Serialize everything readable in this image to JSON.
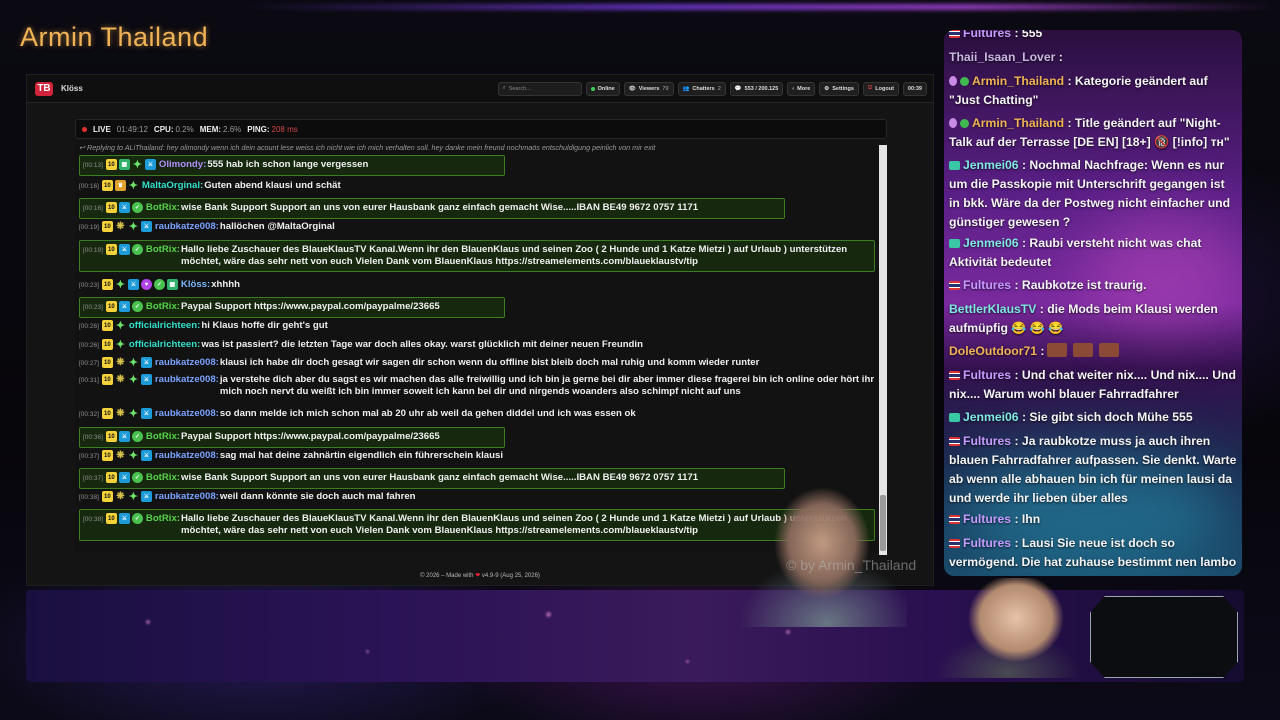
{
  "stream": {
    "title": "Armin Thailand",
    "watermark": "© by Armin_Thailand"
  },
  "app": {
    "name": "Klöss",
    "logo": "TB",
    "search_placeholder": "Search...",
    "status_online": "Online",
    "viewers_label": "Viewers",
    "viewers_count": "79",
    "chatters_label": "Chatters",
    "chatters_count": "2",
    "messages": "553 / 200.125",
    "more_label": "More",
    "settings_label": "Settings",
    "logout_label": "Logout",
    "timer": "00:39",
    "accent_red": "#d0243a"
  },
  "status": {
    "live_label": "LIVE",
    "live_time": "01:49:12",
    "cpu_label": "CPU:",
    "cpu_value": "0.2%",
    "mem_label": "MEM:",
    "mem_value": "2.6%",
    "ping_label": "PING:",
    "ping_value": "208 ms"
  },
  "reply_line": "Replying to ALiThailand: hey olimondy wenn ich dein acount lese weiss ich nicht wie ich mich verhalten soll. hey danke mein freund nochmaös entschuldigung peinlich von mir exit",
  "messages": [
    {
      "ts": "[00:13]",
      "badges": [
        "sub",
        "grn",
        "gem",
        "mod"
      ],
      "user": "Olimondy",
      "color": "#b28cff",
      "text": "555 hab ich schon lange vergessen",
      "hl": true
    },
    {
      "ts": "[00:16]",
      "badges": [
        "sub",
        "vip",
        "gem"
      ],
      "user": "MaltaOrginal",
      "color": "#33e0c8",
      "text": "Guten abend klausi und schät",
      "hl": false
    },
    {
      "ts": "[00:16]",
      "badges": [
        "sub",
        "mod",
        "bot"
      ],
      "user": "BotRix",
      "color": "#57d14a",
      "text": "wise Bank Support Support an uns von eurer Hausbank ganz einfach gemacht Wise.....IBAN BE49 9672 0757 1171",
      "hl": true
    },
    {
      "ts": "[00:19]",
      "badges": [
        "sub",
        "hype",
        "gem",
        "mod"
      ],
      "user": "raubkatze008",
      "color": "#7aa2ff",
      "text": "hallöchen @MaltaOrginal",
      "hl": false
    },
    {
      "ts": "[00:19]",
      "badges": [
        "sub",
        "mod",
        "bot"
      ],
      "user": "BotRix",
      "color": "#57d14a",
      "text": "Hallo liebe Zuschauer des BlaueKlausTV Kanal.Wenn ihr den BlauenKlaus und seinen Zoo ( 2 Hunde und 1 Katze Mietzi ) auf Urlaub ) unterstützen möchtet, wäre das sehr nett von euch Vielen Dank vom BlauenKlaus https://streamelements.com/blaueklaustv/tip",
      "hl": true
    },
    {
      "ts": "[00:23]",
      "badges": [
        "sub",
        "gem",
        "mod",
        "heart",
        "bot",
        "grn"
      ],
      "user": "Klöss",
      "color": "#7ab8ff",
      "text": "xhhhh",
      "hl": false
    },
    {
      "ts": "[00:23]",
      "badges": [
        "sub",
        "mod",
        "bot"
      ],
      "user": "BotRix",
      "color": "#57d14a",
      "text": "Paypal Support https://www.paypal.com/paypalme/23665",
      "hl": true
    },
    {
      "ts": "[00:26]",
      "badges": [
        "sub",
        "gem"
      ],
      "user": "officialrichteen",
      "color": "#33e0c8",
      "text": "hi Klaus hoffe dir geht's gut",
      "hl": false
    },
    {
      "ts": "[00:26]",
      "badges": [
        "sub",
        "gem"
      ],
      "user": "officialrichteen",
      "color": "#33e0c8",
      "text": "was ist passiert? die letzten Tage war doch alles okay. warst glücklich mit deiner neuen Freundin",
      "hl": false
    },
    {
      "ts": "[00:27]",
      "badges": [
        "sub",
        "hype",
        "gem",
        "mod"
      ],
      "user": "raubkatze008",
      "color": "#7aa2ff",
      "text": "klausi ich habe dir doch gesagt wir sagen dir schon wenn du offline bist bleib doch mal ruhig und komm wieder runter",
      "hl": false
    },
    {
      "ts": "[00:31]",
      "badges": [
        "sub",
        "hype",
        "gem",
        "mod"
      ],
      "user": "raubkatze008",
      "color": "#7aa2ff",
      "text": "ja verstehe dich aber du sagst es wir machen das alle freiwillig und ich bin ja gerne bei dir aber immer diese fragerei bin ich online oder hört ihr mich noch nervt du weißt ich bin immer soweit ich kann bei dir und nirgends woanders also schimpf nicht auf uns",
      "hl": false
    },
    {
      "ts": "[00:32]",
      "badges": [
        "sub",
        "hype",
        "gem",
        "mod"
      ],
      "user": "raubkatze008",
      "color": "#7aa2ff",
      "text": "so dann melde ich mich schon mal ab 20 uhr ab weil da gehen diddel und ich was essen ok",
      "hl": false
    },
    {
      "ts": "[00:36]",
      "badges": [
        "sub",
        "mod",
        "bot"
      ],
      "user": "BotRix",
      "color": "#57d14a",
      "text": "Paypal Support https://www.paypal.com/paypalme/23665",
      "hl": true
    },
    {
      "ts": "[00:37]",
      "badges": [
        "sub",
        "hype",
        "gem",
        "mod"
      ],
      "user": "raubkatze008",
      "color": "#7aa2ff",
      "text": "sag mal hat deine zahnärtin eigendlich ein führerschein klausi",
      "hl": false
    },
    {
      "ts": "[00:37]",
      "badges": [
        "sub",
        "mod",
        "bot"
      ],
      "user": "BotRix",
      "color": "#57d14a",
      "text": "wise Bank Support Support an uns von eurer Hausbank ganz einfach gemacht Wise.....IBAN BE49 9672 0757 1171",
      "hl": true
    },
    {
      "ts": "[00:38]",
      "badges": [
        "sub",
        "hype",
        "gem",
        "mod"
      ],
      "user": "raubkatze008",
      "color": "#7aa2ff",
      "text": "weil dann könnte sie doch auch mal fahren",
      "hl": false
    },
    {
      "ts": "[00:38]",
      "badges": [
        "sub",
        "mod",
        "bot"
      ],
      "user": "BotRix",
      "color": "#57d14a",
      "text": "Hallo liebe Zuschauer des BlaueKlausTV Kanal.Wenn ihr den BlauenKlaus und seinen Zoo ( 2 Hunde und 1 Katze Mietzi ) auf Urlaub ) unterstützen möchtet, wäre das sehr nett von euch Vielen Dank vom BlauenKlaus https://streamelements.com/blaueklaustv/tip",
      "hl": true
    }
  ],
  "footer": {
    "text": "© 2026 – Made with",
    "heart": "❤",
    "version": "v4.9-9 (Aug 25, 2026)"
  },
  "overlay": {
    "messages": [
      {
        "icon": "flag",
        "user": "Fultures",
        "color": "#c59bff",
        "text": ": 555"
      },
      {
        "icon": "none",
        "user": "Thaii_Isaan_Lover",
        "color": "#c8b7e0",
        "text": ":"
      },
      {
        "icon": "purple-chk",
        "user": "Armin_Thailand",
        "color": "#f0b356",
        "text": ": Kategorie geändert auf \"Just Chatting\""
      },
      {
        "icon": "purple-chk",
        "user": "Armin_Thailand",
        "color": "#f0b356",
        "text": ": Title geändert auf \"Night-Talk auf der Terrasse [DE EN] [18+] 🔞 [!info] ᴛʜ\""
      },
      {
        "icon": "grid",
        "user": "Jenmei06",
        "color": "#7fe8e0",
        "text": ": Nochmal Nachfrage: Wenn es nur um die Passkopie mit Unterschrift gegangen ist in bkk. Wäre da der Postweg nicht einfacher und günstiger gewesen ?"
      },
      {
        "icon": "grid",
        "user": "Jenmei06",
        "color": "#7fe8e0",
        "text": ": Raubi versteht nicht was chat Aktivität bedeutet"
      },
      {
        "icon": "flag",
        "user": "Fultures",
        "color": "#c59bff",
        "text": ": Raubkotze ist traurig."
      },
      {
        "icon": "none",
        "user": "BettlerKlausTV",
        "color": "#7fe8e0",
        "text": ": die Mods beim Klausi werden aufmüpfig 😂 😂 😂"
      },
      {
        "icon": "none",
        "user": "DoleOutdoor71",
        "color": "#f0b356",
        "text": ":"
      },
      {
        "icon": "flag",
        "user": "Fultures",
        "color": "#c59bff",
        "text": ": Und chat weiter nix.... Und nix.... Und nix.... Warum wohl blauer Fahrradfahrer"
      },
      {
        "icon": "grid",
        "user": "Jenmei06",
        "color": "#7fe8e0",
        "text": ": Sie gibt sich doch Mühe 555"
      },
      {
        "icon": "flag",
        "user": "Fultures",
        "color": "#c59bff",
        "text": ": Ja raubkotze muss ja auch ihren blauen Fahrradfahrer aufpassen. Sie denkt. Warte ab wenn alle abhauen bin ich für meinen lausi da und werde ihr lieben über alles"
      },
      {
        "icon": "flag",
        "user": "Fultures",
        "color": "#c59bff",
        "text": ": Ihn"
      },
      {
        "icon": "flag",
        "user": "Fultures",
        "color": "#c59bff",
        "text": ": Lausi Sie neue ist doch so vermögend. Die hat zuhause bestimmt nen lambo"
      }
    ]
  }
}
